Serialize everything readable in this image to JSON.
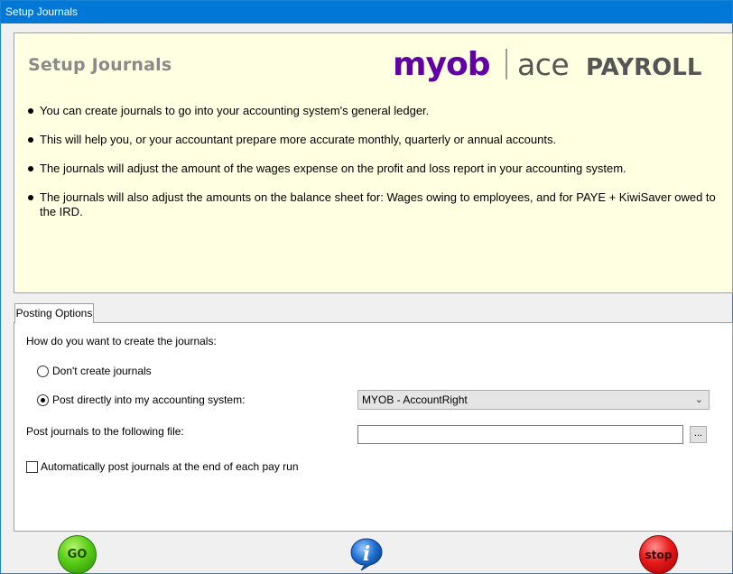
{
  "window": {
    "title": "Setup Journals"
  },
  "info": {
    "heading": "Setup Journals",
    "logo_text": "myob | ace PAYROLL",
    "bullets": [
      "You can create journals to go into your accounting system's general ledger.",
      "This will help you, or your accountant prepare more accurate monthly, quarterly or annual accounts.",
      "The journals will adjust the amount of the wages expense on the profit and loss report in your accounting system.",
      "The journals will also adjust the amounts on the balance sheet for: Wages owing to employees, and for PAYE + KiwiSaver owed to the IRD."
    ]
  },
  "tabs": [
    {
      "label": "Posting Options",
      "active": true
    }
  ],
  "posting": {
    "question": "How do you want to create the journals:",
    "option_none": "Don't create journals",
    "option_direct": "Post directly into my accounting system:",
    "selected_option": "direct",
    "accounting_system": "MYOB - AccountRight",
    "file_label": "Post journals to the following file:",
    "file_value": "",
    "browse_label": "...",
    "auto_post_label": "Automatically post journals at the end of each pay run",
    "auto_post_checked": false
  },
  "buttons": {
    "go": "GO",
    "stop": "stop",
    "info": "i"
  },
  "colors": {
    "titlebar": "#0078d7",
    "info_bg": "#ffffe1",
    "myob_purple": "#6100a5",
    "go_green": "#59cc17",
    "stop_red": "#e81a1a",
    "info_blue": "#1f6fd1"
  }
}
